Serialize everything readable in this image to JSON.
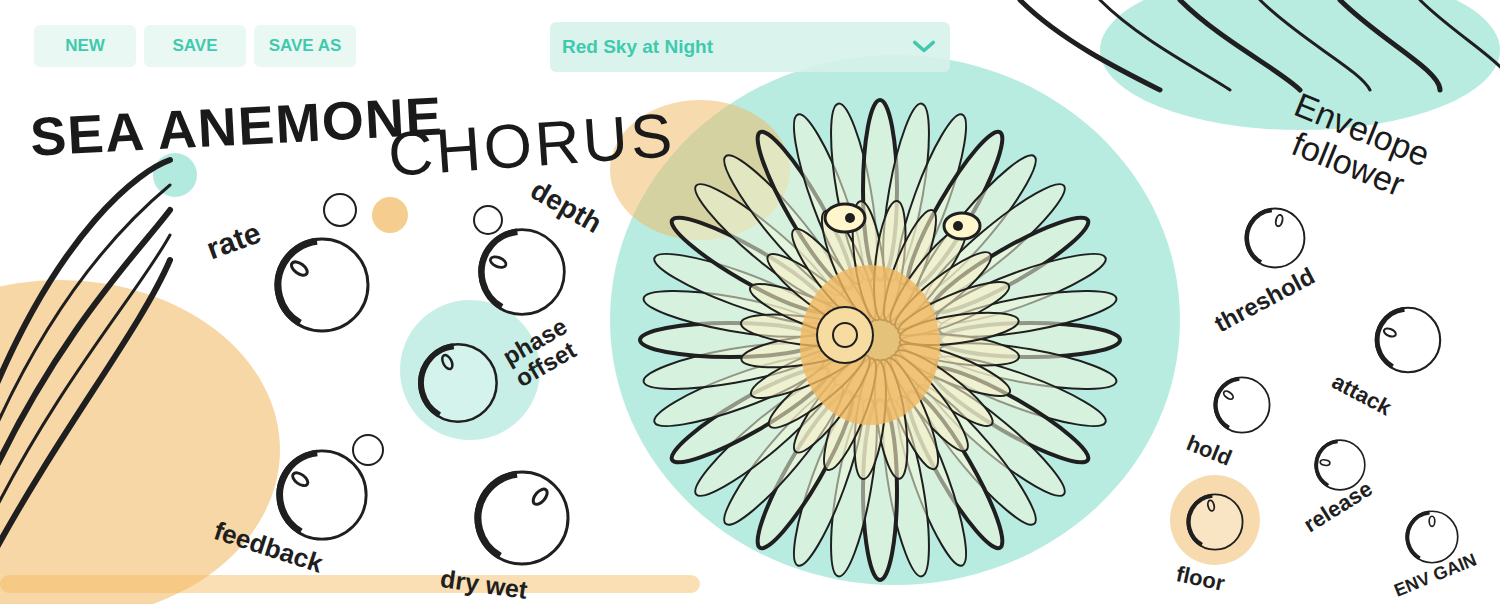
{
  "header": {
    "buttons": [
      "NEW",
      "SAVE",
      "SAVE AS"
    ],
    "preset": {
      "value": "Red Sky at Night"
    }
  },
  "title": {
    "line1": "SEA ANEMONE",
    "line2": "CHORUS"
  },
  "chorus": {
    "knobs": [
      {
        "label": "rate",
        "level": 0.3
      },
      {
        "label": "depth",
        "level": 0.25
      },
      {
        "label": "phase offset",
        "level": 0.4
      },
      {
        "label": "feedback",
        "level": 0.3
      },
      {
        "label": "dry wet",
        "level": 0.65
      }
    ]
  },
  "envelope_follower": {
    "title": "Envelope follower",
    "knobs": [
      {
        "label": "threshold",
        "level": 0.55
      },
      {
        "label": "attack",
        "level": 0.25
      },
      {
        "label": "hold",
        "level": 0.3
      },
      {
        "label": "release",
        "level": 0.2
      },
      {
        "label": "floor",
        "level": 0.45
      },
      {
        "label": "ENV GAIN",
        "level": 0.5
      }
    ]
  }
}
